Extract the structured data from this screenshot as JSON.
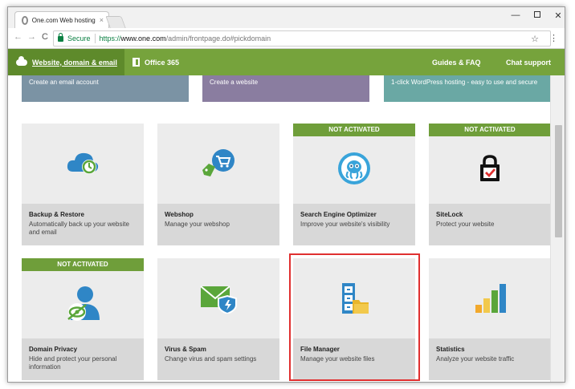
{
  "browser": {
    "tab_title": "One.com Web hosting",
    "tab_close": "×",
    "secure_label": "Secure",
    "url_scheme": "https://",
    "url_host": "www.one.com",
    "url_path": "/admin/frontpage.do#pickdomain",
    "back": "←",
    "forward": "→",
    "reload": "C",
    "star": "☆",
    "menu": "⋮",
    "minimize": "—",
    "close": "✕"
  },
  "nav": {
    "active_label": "Website, domain & email",
    "office_label": "Office 365",
    "guides_label": "Guides & FAQ",
    "chat_label": "Chat support"
  },
  "top_cards": [
    {
      "text": "Create an email account"
    },
    {
      "text": "Create a website"
    },
    {
      "text": "1-click WordPress hosting - easy to use and secure"
    }
  ],
  "cards": [
    {
      "title": "Backup & Restore",
      "desc": "Automatically back up your website and email",
      "icon": "cloud-backup-icon",
      "banner": ""
    },
    {
      "title": "Webshop",
      "desc": "Manage your webshop",
      "icon": "shopping-cart-icon",
      "banner": ""
    },
    {
      "title": "Search Engine Optimizer",
      "desc": "Improve your website's visibility",
      "icon": "octopus-icon",
      "banner": "NOT ACTIVATED"
    },
    {
      "title": "SiteLock",
      "desc": "Protect your website",
      "icon": "padlock-icon",
      "banner": "NOT ACTIVATED"
    },
    {
      "title": "Domain Privacy",
      "desc": "Hide and protect your personal information",
      "icon": "privacy-user-icon",
      "banner": "NOT ACTIVATED"
    },
    {
      "title": "Virus & Spam",
      "desc": "Change virus and spam settings",
      "icon": "envelope-shield-icon",
      "banner": ""
    },
    {
      "title": "File Manager",
      "desc": "Manage your website files",
      "icon": "file-cabinet-icon",
      "banner": ""
    },
    {
      "title": "Statistics",
      "desc": "Analyze your website traffic",
      "icon": "bar-chart-icon",
      "banner": ""
    }
  ],
  "colors": {
    "brand_green": "#76a33c",
    "highlight": "#e03030"
  }
}
